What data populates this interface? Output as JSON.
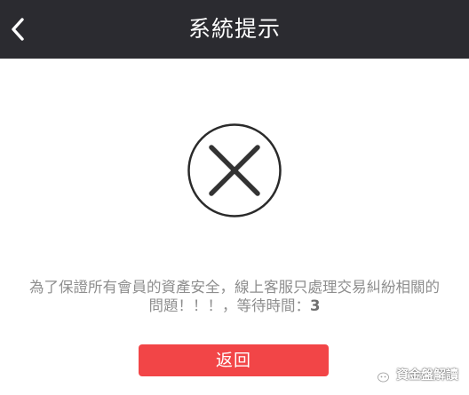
{
  "header": {
    "title": "系統提示",
    "back_icon": "chevron-left-icon"
  },
  "status": {
    "icon": "close-circle-icon"
  },
  "message": {
    "line1": "為了保證所有會員的資產安全，線上客服只處理交易糾紛相關的",
    "line2_text": "問題！！！，等待時間：",
    "countdown": "3"
  },
  "actions": {
    "return_label": "返回"
  },
  "watermark": {
    "icon": "wechat-icon",
    "text": "資金盤解讀"
  },
  "colors": {
    "nav_bg": "#2b2b30",
    "accent": "#f24547",
    "message_text": "#8e8e8e"
  }
}
